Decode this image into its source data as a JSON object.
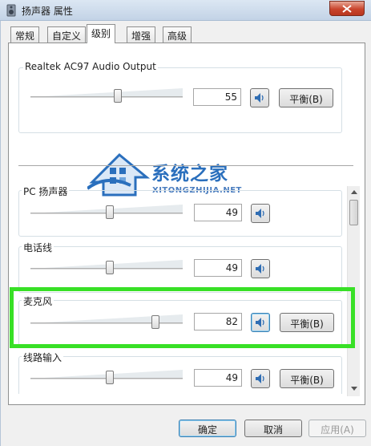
{
  "window": {
    "title": "扬声器 属性",
    "close_icon": "close-x-icon",
    "app_icon": "speaker-device-icon"
  },
  "tabs": [
    {
      "label": "常规",
      "active": false
    },
    {
      "label": "自定义",
      "active": false
    },
    {
      "label": "级别",
      "active": true
    },
    {
      "label": "增强",
      "active": false
    },
    {
      "label": "高级",
      "active": false
    }
  ],
  "main_output": {
    "label": "Realtek AC97 Audio Output",
    "value": "55",
    "balance_label": "平衡(B)"
  },
  "watermark": {
    "title": "系统之家",
    "subtitle": "XITONGZHIJIA.NET"
  },
  "channels": [
    {
      "label": "PC 扬声器",
      "value": "49",
      "has_balance": false
    },
    {
      "label": "电话线",
      "value": "49",
      "has_balance": false
    },
    {
      "label": "麦克风",
      "value": "82",
      "has_balance": true,
      "balance_label": "平衡(B)"
    },
    {
      "label": "线路输入",
      "value": "49",
      "has_balance": true,
      "balance_label": "平衡(B)"
    }
  ],
  "footer": {
    "ok": "确定",
    "cancel": "取消",
    "apply": "应用(A)"
  },
  "colors": {
    "highlight": "#38e026",
    "accent": "#2a6fbd"
  }
}
